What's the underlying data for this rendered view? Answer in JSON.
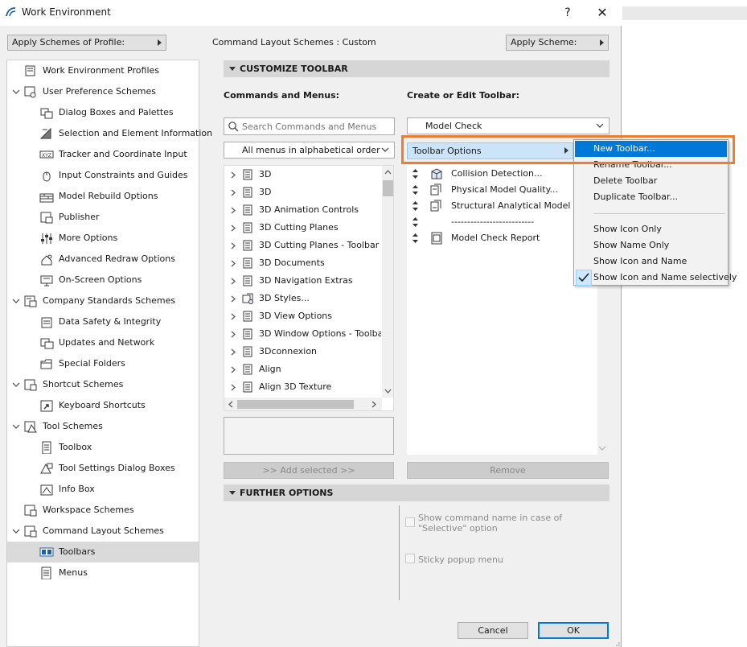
{
  "window": {
    "title": "Work Environment",
    "help_label": "?",
    "close_label": "✕"
  },
  "topbar": {
    "apply_profile_label": "Apply Schemes of Profile:",
    "command_layout_label": "Command Layout Schemes :  Custom",
    "apply_scheme_label": "Apply Scheme:"
  },
  "tree": {
    "items": [
      {
        "label": "Work Environment Profiles",
        "level": 0,
        "icon": "profiles-icon",
        "expand": "none"
      },
      {
        "label": "User Preference Schemes",
        "level": 0,
        "icon": "user-preference-icon",
        "expand": "open"
      },
      {
        "label": "Dialog Boxes and Palettes",
        "level": 1,
        "icon": "dialog-boxes-icon",
        "expand": "none"
      },
      {
        "label": "Selection and Element Information",
        "level": 1,
        "icon": "selection-icon",
        "expand": "none"
      },
      {
        "label": "Tracker and Coordinate Input",
        "level": 1,
        "icon": "tracker-xyz-icon",
        "expand": "none"
      },
      {
        "label": "Input Constraints and Guides",
        "level": 1,
        "icon": "mouse-icon",
        "expand": "none"
      },
      {
        "label": "Model Rebuild Options",
        "level": 1,
        "icon": "brick-wall-icon",
        "expand": "none"
      },
      {
        "label": "Publisher",
        "level": 1,
        "icon": "publisher-icon",
        "expand": "none"
      },
      {
        "label": "More Options",
        "level": 1,
        "icon": "sliders-icon",
        "expand": "none"
      },
      {
        "label": "Advanced Redraw Options",
        "level": 1,
        "icon": "redraw-icon",
        "expand": "none"
      },
      {
        "label": "On-Screen Options",
        "level": 1,
        "icon": "monitor-icon",
        "expand": "none"
      },
      {
        "label": "Company Standards Schemes",
        "level": 0,
        "icon": "company-standards-icon",
        "expand": "open"
      },
      {
        "label": "Data Safety & Integrity",
        "level": 1,
        "icon": "data-safety-icon",
        "expand": "none"
      },
      {
        "label": "Updates and Network",
        "level": 1,
        "icon": "network-icon",
        "expand": "none"
      },
      {
        "label": "Special Folders",
        "level": 1,
        "icon": "folder-icon",
        "expand": "none"
      },
      {
        "label": "Shortcut Schemes",
        "level": 0,
        "icon": "shortcut-schemes-icon",
        "expand": "open"
      },
      {
        "label": "Keyboard Shortcuts",
        "level": 1,
        "icon": "keyboard-shortcut-icon",
        "expand": "none"
      },
      {
        "label": "Tool Schemes",
        "level": 0,
        "icon": "tool-schemes-icon",
        "expand": "open"
      },
      {
        "label": "Toolbox",
        "level": 1,
        "icon": "toolbox-icon",
        "expand": "none"
      },
      {
        "label": "Tool Settings Dialog Boxes",
        "level": 1,
        "icon": "tool-settings-icon",
        "expand": "none"
      },
      {
        "label": "Info Box",
        "level": 1,
        "icon": "info-box-icon",
        "expand": "none"
      },
      {
        "label": "Workspace Schemes",
        "level": 0,
        "icon": "workspace-icon",
        "expand": "none"
      },
      {
        "label": "Command Layout Schemes",
        "level": 0,
        "icon": "command-layout-icon",
        "expand": "open"
      },
      {
        "label": "Toolbars",
        "level": 1,
        "icon": "toolbars-icon",
        "expand": "none",
        "selected": true
      },
      {
        "label": "Menus",
        "level": 1,
        "icon": "menus-icon",
        "expand": "none"
      }
    ]
  },
  "customize": {
    "header": "CUSTOMIZE TOOLBAR",
    "commands_label": "Commands and Menus:",
    "edit_label": "Create or Edit Toolbar:",
    "search_placeholder": "Search Commands and Menus",
    "menu_filter_value": "All menus in alphabetical order",
    "toolbar_value": "Model Check",
    "toolbar_options_label": "Toolbar Options",
    "add_selected_label": ">> Add selected >>",
    "remove_label": "Remove"
  },
  "commands": [
    "3D",
    "3D",
    "3D Animation Controls",
    "3D Cutting Planes",
    "3D Cutting Planes - Toolbar",
    "3D Documents",
    "3D Navigation Extras",
    "3D Styles...",
    "3D View Options",
    "3D Window Options - Toolbar",
    "3Dconnexion",
    "Align",
    "Align 3D Texture"
  ],
  "toolbar_items": [
    {
      "label": "Collision Detection...",
      "icon": "collision-detection-icon"
    },
    {
      "label": "Physical Model Quality...",
      "icon": "physical-model-icon"
    },
    {
      "label": "Structural Analytical Model ...",
      "icon": "structural-model-icon"
    },
    {
      "label": "--------------------------",
      "icon": "separator"
    },
    {
      "label": "Model Check Report",
      "icon": "report-icon"
    }
  ],
  "options_menu": {
    "items": [
      "New Toolbar...",
      "Rename Toolbar...",
      "Delete Toolbar",
      "Duplicate Toolbar...",
      "Show Icon Only",
      "Show Name Only",
      "Show Icon and Name",
      "Show Icon and Name selectively"
    ],
    "highlighted_index": 0,
    "checked_index": 7
  },
  "further": {
    "header": "FURTHER OPTIONS",
    "show_name_label": "Show command name in case of \"Selective\" option",
    "sticky_label": "Sticky popup menu"
  },
  "footer": {
    "cancel_label": "Cancel",
    "ok_label": "OK"
  },
  "colors": {
    "accent": "#0078d7",
    "highlight_frame": "#ed7d31",
    "selected_row": "#dadada",
    "options_button": "#cce4f7"
  }
}
